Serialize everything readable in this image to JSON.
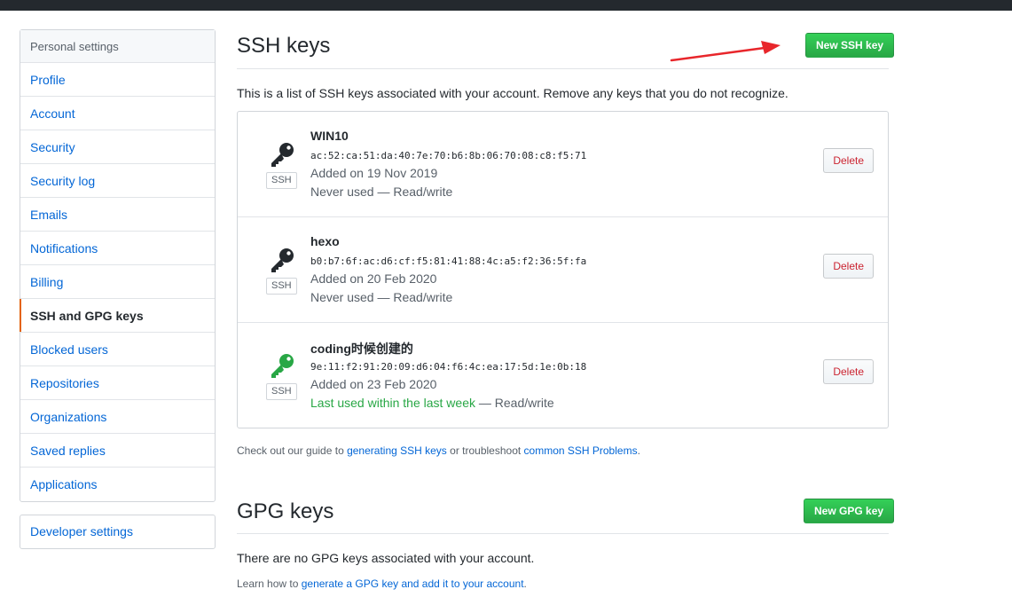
{
  "sidebar": {
    "heading": "Personal settings",
    "items": [
      {
        "label": "Profile"
      },
      {
        "label": "Account"
      },
      {
        "label": "Security"
      },
      {
        "label": "Security log"
      },
      {
        "label": "Emails"
      },
      {
        "label": "Notifications"
      },
      {
        "label": "Billing"
      },
      {
        "label": "SSH and GPG keys",
        "selected": true
      },
      {
        "label": "Blocked users"
      },
      {
        "label": "Repositories"
      },
      {
        "label": "Organizations"
      },
      {
        "label": "Saved replies"
      },
      {
        "label": "Applications"
      }
    ],
    "developer_settings": "Developer settings"
  },
  "ssh": {
    "title": "SSH keys",
    "new_button": "New SSH key",
    "description": "This is a list of SSH keys associated with your account. Remove any keys that you do not recognize.",
    "keys": [
      {
        "title": "WIN10",
        "fingerprint": "ac:52:ca:51:da:40:7e:70:b6:8b:06:70:08:c8:f5:71",
        "added": "Added on 19 Nov 2019",
        "used": "Never used",
        "access": " — Read/write",
        "badge": "SSH",
        "delete_label": "Delete",
        "icon": "key-icon-black"
      },
      {
        "title": "hexo",
        "fingerprint": "b0:b7:6f:ac:d6:cf:f5:81:41:88:4c:a5:f2:36:5f:fa",
        "added": "Added on 20 Feb 2020",
        "used": "Never used",
        "access": " — Read/write",
        "badge": "SSH",
        "delete_label": "Delete",
        "icon": "key-icon-black"
      },
      {
        "title": "coding时候创建的",
        "fingerprint": "9e:11:f2:91:20:09:d6:04:f6:4c:ea:17:5d:1e:0b:18",
        "added": "Added on 23 Feb 2020",
        "used": "Last used within the last week",
        "access": " — Read/write",
        "badge": "SSH",
        "delete_label": "Delete",
        "icon": "key-icon-green"
      }
    ],
    "guide": {
      "prefix": "Check out our guide to ",
      "link1": "generating SSH keys",
      "middle": " or troubleshoot ",
      "link2": "common SSH Problems",
      "suffix": "."
    }
  },
  "gpg": {
    "title": "GPG keys",
    "new_button": "New GPG key",
    "empty": "There are no GPG keys associated with your account.",
    "learn": {
      "prefix": "Learn how to ",
      "link": "generate a GPG key and add it to your account",
      "suffix": "."
    }
  },
  "colors": {
    "link": "#0366d6",
    "green": "#28a745",
    "danger": "#cb2431",
    "annotation_arrow": "#e8262b"
  }
}
